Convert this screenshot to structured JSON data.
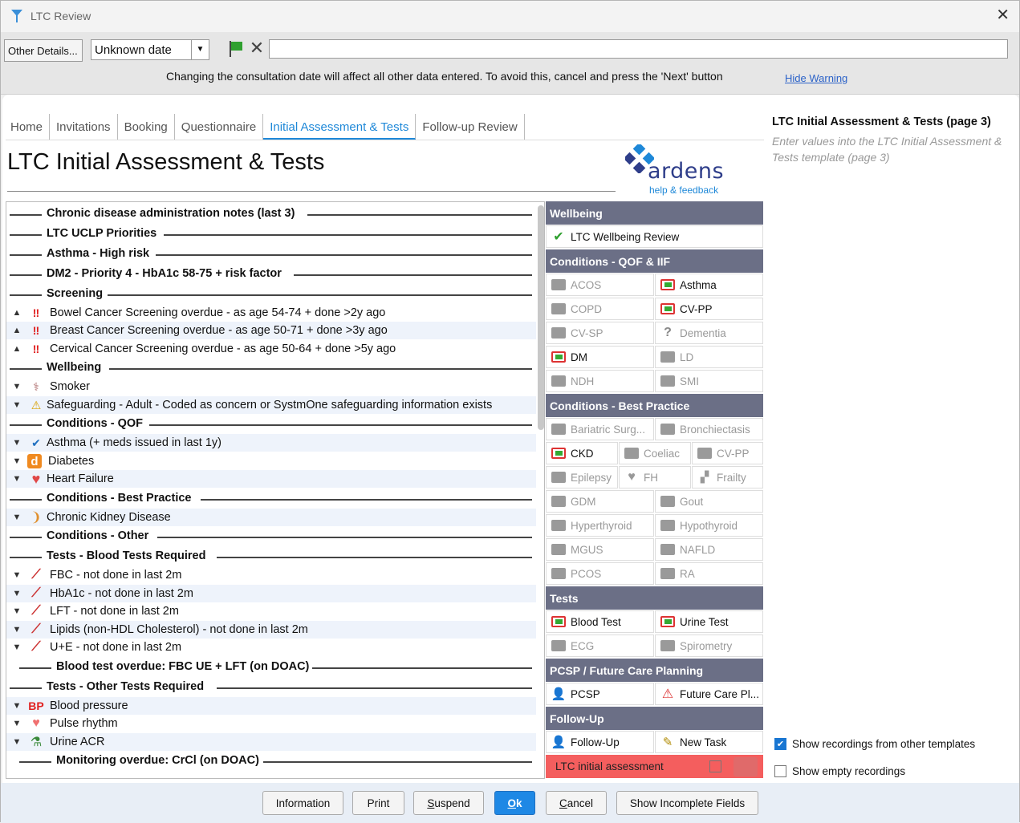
{
  "window": {
    "title": "LTC Review"
  },
  "toolbar": {
    "other_details": "Other Details...",
    "date_value": "Unknown date",
    "warning": "Changing the consultation date will affect all other data entered. To avoid this, cancel and press the 'Next' button",
    "hide_warning": "Hide Warning"
  },
  "tabs": [
    "Home",
    "Invitations",
    "Booking",
    "Questionnaire",
    "Initial Assessment & Tests",
    "Follow-up Review"
  ],
  "page": {
    "title": "LTC Initial Assessment & Tests",
    "brand": "ardens",
    "brand_link": "help & feedback"
  },
  "list": {
    "h1": "Chronic disease administration notes (last 3)",
    "h2": "LTC UCLP Priorities",
    "h3": "Asthma - High risk",
    "h4": "DM2 - Priority 4 - HbA1c 58-75 + risk factor",
    "h5": "Screening",
    "r1": "Bowel Cancer Screening overdue - as age 54-74 + done >2y ago",
    "r2": "Breast Cancer Screening overdue - as age 50-71 + done >3y ago",
    "r3": "Cervical Cancer Screening overdue - as age 50-64 + done >5y ago",
    "h6": "Wellbeing",
    "r4": "Smoker",
    "r5": "Safeguarding - Adult - Coded as concern or SystmOne safeguarding information exists",
    "h7": "Conditions - QOF",
    "r6": "Asthma (+ meds issued in last 1y)",
    "r7": "Diabetes",
    "r8": "Heart Failure",
    "h8": "Conditions - Best Practice",
    "r9": "Chronic Kidney Disease",
    "h9": "Conditions - Other",
    "h10": "Tests - Blood Tests Required",
    "r10": "FBC - not done in last 2m",
    "r11": "HbA1c - not done in last 2m",
    "r12": "LFT - not done in last 2m",
    "r13": "Lipids (non-HDL Cholesterol) - not done in last 2m",
    "r14": "U+E - not done in last 2m",
    "h11": "Blood test overdue: FBC UE + LFT (on DOAC)",
    "h12": "Tests - Other Tests Required",
    "r15": "Blood pressure",
    "r16": "Pulse rhythm",
    "r17": "Urine ACR",
    "h13": "Monitoring overdue: CrCl (on DOAC)",
    "bp_icon": "BP"
  },
  "grid": {
    "s1": "Wellbeing",
    "wellbeing": "LTC Wellbeing Review",
    "s2": "Conditions - QOF & IIF",
    "acos": "ACOS",
    "asthma": "Asthma",
    "copd": "COPD",
    "cvpp": "CV-PP",
    "cvsp": "CV-SP",
    "dementia": "Dementia",
    "dm": "DM",
    "ld": "LD",
    "ndh": "NDH",
    "smi": "SMI",
    "s3": "Conditions - Best Practice",
    "bariatric": "Bariatric Surg...",
    "bronch": "Bronchiectasis",
    "ckd": "CKD",
    "coeliac": "Coeliac",
    "cvpp2": "CV-PP",
    "epilepsy": "Epilepsy",
    "fh": "FH",
    "frailty": "Frailty",
    "gdm": "GDM",
    "gout": "Gout",
    "hyper": "Hyperthyroid",
    "hypo": "Hypothyroid",
    "mgus": "MGUS",
    "nafld": "NAFLD",
    "pcos": "PCOS",
    "ra": "RA",
    "s4": "Tests",
    "blood": "Blood Test",
    "urine": "Urine Test",
    "ecg": "ECG",
    "spiro": "Spirometry",
    "s5": "PCSP / Future Care Planning",
    "pcsp": "PCSP",
    "future": "Future Care Pl...",
    "s6": "Follow-Up",
    "followup": "Follow-Up",
    "newtask": "New Task",
    "ltc": "LTC initial assessment"
  },
  "side": {
    "heading": "LTC Initial Assessment & Tests (page 3)",
    "desc": "Enter values into the LTC Initial Assessment & Tests template (page 3)",
    "chk1": "Show recordings from other templates",
    "chk2": "Show empty recordings"
  },
  "footer": {
    "information": "Information",
    "print": "Print",
    "suspend_u": "S",
    "suspend": "uspend",
    "ok_u": "O",
    "ok": "k",
    "cancel_u": "C",
    "cancel": "ancel",
    "incomplete": "Show Incomplete Fields"
  }
}
